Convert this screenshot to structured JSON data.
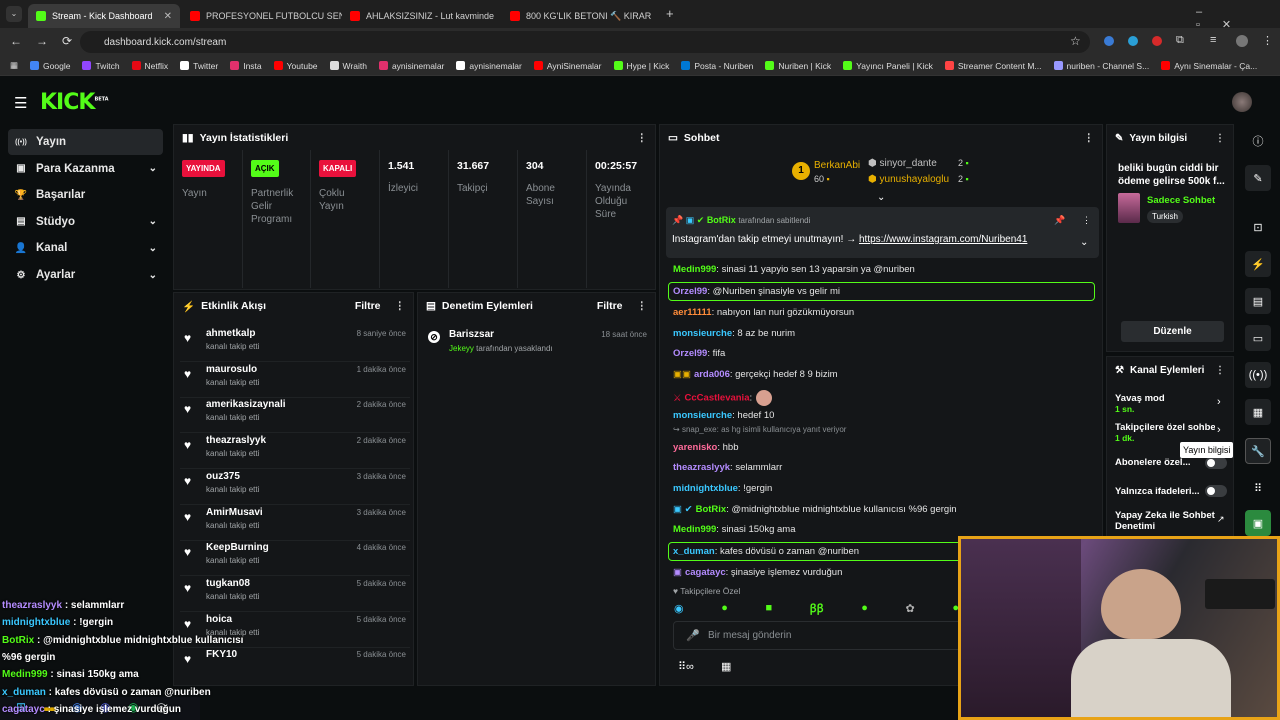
{
  "browser": {
    "tabs": [
      {
        "label": "Stream - Kick Dashboard",
        "active": true,
        "icon": "kick-icon",
        "color": "#53fc18"
      },
      {
        "label": "PROFESYONEL FUTBOLCU SEN",
        "active": false,
        "icon": "youtube-icon",
        "color": "#ff0000"
      },
      {
        "label": "AHLAKSIZSINIZ - Lut kavminde",
        "active": false,
        "icon": "youtube-icon",
        "color": "#ff0000"
      },
      {
        "label": "800 KG'LIK BETONI 🔨 KIRAR",
        "active": false,
        "icon": "youtube-icon",
        "color": "#ff0000"
      }
    ],
    "url": "dashboard.kick.com/stream",
    "bookmarks": [
      {
        "label": "Google",
        "color": "#4285f4"
      },
      {
        "label": "Twitch",
        "color": "#9146ff"
      },
      {
        "label": "Netflix",
        "color": "#e50914"
      },
      {
        "label": "Twitter",
        "color": "#ffffff"
      },
      {
        "label": "Insta",
        "color": "#e1306c"
      },
      {
        "label": "Youtube",
        "color": "#ff0000"
      },
      {
        "label": "Wraith",
        "color": "#dddddd"
      },
      {
        "label": "aynisinemalar",
        "color": "#e1306c"
      },
      {
        "label": "aynisinemalar",
        "color": "#ffffff"
      },
      {
        "label": "AyniSinemalar",
        "color": "#ff0000"
      },
      {
        "label": "Hype | Kick",
        "color": "#53fc18"
      },
      {
        "label": "Posta - Nuriben",
        "color": "#0078d4"
      },
      {
        "label": "Nuriben | Kick",
        "color": "#53fc18"
      },
      {
        "label": "Yayıncı Paneli | Kick",
        "color": "#53fc18"
      },
      {
        "label": "Streamer Content M...",
        "color": "#ff4444"
      },
      {
        "label": "nuriben - Channel S...",
        "color": "#9999ff"
      },
      {
        "label": "Aynı Sinemalar - Ça...",
        "color": "#ff0000"
      }
    ]
  },
  "app": {
    "logo": "KICK",
    "logo_sup": "BETA",
    "accent": "#53fc18"
  },
  "nav": {
    "items": [
      {
        "label": "Yayın",
        "icon": "broadcast-icon",
        "active": true,
        "expandable": false
      },
      {
        "label": "Para Kazanma",
        "icon": "money-icon",
        "active": false,
        "expandable": true
      },
      {
        "label": "Başarılar",
        "icon": "trophy-icon",
        "active": false,
        "expandable": false
      },
      {
        "label": "Stüdyo",
        "icon": "studio-icon",
        "active": false,
        "expandable": true
      },
      {
        "label": "Kanal",
        "icon": "user-icon",
        "active": false,
        "expandable": true
      },
      {
        "label": "Ayarlar",
        "icon": "gear-icon",
        "active": false,
        "expandable": true
      }
    ]
  },
  "stats": {
    "title": "Yayın İstatistikleri",
    "columns": [
      {
        "badge": "YAYINDA",
        "badge_color": "#e9113c",
        "label": "Yayın"
      },
      {
        "badge": "AÇIK",
        "badge_color": "#53fc18",
        "label": "Partnerlik Gelir Programı"
      },
      {
        "badge": "KAPALI",
        "badge_color": "#e9113c",
        "label": "Çoklu Yayın"
      },
      {
        "value": "1.541",
        "label": "İzleyici"
      },
      {
        "value": "31.667",
        "label": "Takipçi"
      },
      {
        "value": "304",
        "label": "Abone Sayısı"
      },
      {
        "value": "00:25:57",
        "label": "Yayında Olduğu Süre"
      }
    ]
  },
  "activity": {
    "title": "Etkinlik Akışı",
    "filter": "Filtre",
    "events": [
      {
        "name": "ahmetkalp",
        "sub": "kanalı takip etti",
        "time": "8 saniye önce"
      },
      {
        "name": "maurosulo",
        "sub": "kanalı takip etti",
        "time": "1 dakika önce"
      },
      {
        "name": "amerikasizaynali",
        "sub": "kanalı takip etti",
        "time": "2 dakika önce"
      },
      {
        "name": "theazraslyyk",
        "sub": "kanalı takip etti",
        "time": "2 dakika önce"
      },
      {
        "name": "ouz375",
        "sub": "kanalı takip etti",
        "time": "3 dakika önce"
      },
      {
        "name": "AmirMusavi",
        "sub": "kanalı takip etti",
        "time": "3 dakika önce"
      },
      {
        "name": "KeepBurning",
        "sub": "kanalı takip etti",
        "time": "4 dakika önce"
      },
      {
        "name": "tugkan08",
        "sub": "kanalı takip etti",
        "time": "5 dakika önce"
      },
      {
        "name": "hoica",
        "sub": "kanalı takip etti",
        "time": "5 dakika önce"
      },
      {
        "name": "FKY10",
        "sub": "",
        "time": "5 dakika önce"
      }
    ]
  },
  "moderation": {
    "title": "Denetim Eylemleri",
    "filter": "Filtre",
    "items": [
      {
        "name": "Bariszsar",
        "by": "Jekeyy",
        "action": "tarafından yasaklandı",
        "time": "18 saat önce"
      }
    ]
  },
  "chat": {
    "title": "Sohbet",
    "leaders": [
      {
        "rank": "1",
        "name": "BerkanAbi",
        "count": "60"
      },
      {
        "name": "sinyor_dante",
        "count": "2"
      },
      {
        "name": "yunushayaloglu",
        "count": "2"
      }
    ],
    "pinned": {
      "author": "BotRix",
      "pinned_by": "tarafından sabitlendi",
      "text": "Instagram'dan takip etmeyi unutmayın! →",
      "link": "https://www.instagram.com/Nuriben41"
    },
    "messages": [
      {
        "user": "Medin999",
        "color": "#53fc18",
        "text": ": sinasi 11 yapyio sen 13 yaparsin ya @nuriben",
        "highlight": false
      },
      {
        "user": "Orzel99",
        "color": "#b48cff",
        "text": ": @Nuriben şinasiyle vs gelir mi",
        "highlight": true
      },
      {
        "user": "aer11111",
        "color": "#ff8c3a",
        "text": ": nabıyon lan nuri gözükmüyorsun",
        "highlight": false
      },
      {
        "user": "monsieurche",
        "color": "#3ac8ff",
        "text": ": 8 az be nurim",
        "highlight": false
      },
      {
        "user": "Orzel99",
        "color": "#b48cff",
        "text": ": fifa",
        "highlight": false
      },
      {
        "user": "arda006",
        "color": "#b48cff",
        "text": ": gerçekçi hedef 8 9 bizim",
        "highlight": false
      },
      {
        "user": "CcCastlevania",
        "color": "#e9113c",
        "text": ":",
        "highlight": false
      },
      {
        "user": "monsieurche",
        "color": "#3ac8ff",
        "text": ": hedef 10",
        "highlight": false
      },
      {
        "reply": "snap_exe: as hg isimli kullanıcıya yanıt veriyor"
      },
      {
        "user": "yarenisko",
        "color": "#ff6b9a",
        "text": ": hbb",
        "highlight": false
      },
      {
        "user": "theazraslyyk",
        "color": "#b48cff",
        "text": ": selammlarr",
        "highlight": false
      },
      {
        "user": "midnightxblue",
        "color": "#3ac8ff",
        "text": ": !gergin",
        "highlight": false
      },
      {
        "user": "BotRix",
        "color": "#53fc18",
        "text": ": @midnightxblue midnightxblue kullanıcısı %96 gergin",
        "highlight": false
      },
      {
        "user": "Medin999",
        "color": "#53fc18",
        "text": ": sinasi 150kg ama",
        "highlight": false
      },
      {
        "user": "x_duman",
        "color": "#3ac8ff",
        "text": ": kafes dövüsü o zaman @nuriben",
        "highlight": true
      },
      {
        "user": "cagatayc",
        "color": "#b48cff",
        "text": ": şinasiye işlemez vurduğun",
        "highlight": false
      }
    ],
    "followers_only": "Takipçilere Özel",
    "input_placeholder": "Bir mesaj gönderin"
  },
  "stream_info": {
    "title": "Yayın bilgisi",
    "stream_title": "beliki bugün ciddi bir ödeme gelirse 500k f...",
    "category": "Sadece Sohbet",
    "language": "Turkish",
    "edit": "Düzenle"
  },
  "channel_actions": {
    "title": "Kanal Eylemleri",
    "items": [
      {
        "label": "Yavaş mod",
        "value": "1 sn.",
        "kind": "arrow"
      },
      {
        "label": "Takipçilere özel sohbet",
        "value": "1 dk.",
        "kind": "arrow"
      },
      {
        "label": "Abonelere özel...",
        "kind": "toggle"
      },
      {
        "label": "Yalnızca ifadeleri...",
        "kind": "toggle"
      },
      {
        "label": "Yapay Zeka ile Sohbet Denetimi",
        "kind": "external"
      }
    ]
  },
  "tooltip": "Yayın bilgisi",
  "overlay_chat": [
    {
      "user": "theazraslyyk",
      "color": "#b48cff",
      "text": " : selammlarr"
    },
    {
      "user": "midnightxblue",
      "color": "#3ac8ff",
      "text": " : !gergin"
    },
    {
      "user": "BotRix",
      "color": "#53fc18",
      "text": " : @midnightxblue midnightxblue kullanıcısı"
    },
    {
      "user": "",
      "color": "#ffffff",
      "text": "%96 gergin"
    },
    {
      "user": "Medin999",
      "color": "#53fc18",
      "text": " : sinasi 150kg ama"
    },
    {
      "user": "x_duman",
      "color": "#3ac8ff",
      "text": " : kafes dövüsü o zaman @nuriben"
    },
    {
      "user": "cagatayc",
      "color": "#b48cff",
      "text": " : şinasiye işlemez vurduğun"
    }
  ]
}
